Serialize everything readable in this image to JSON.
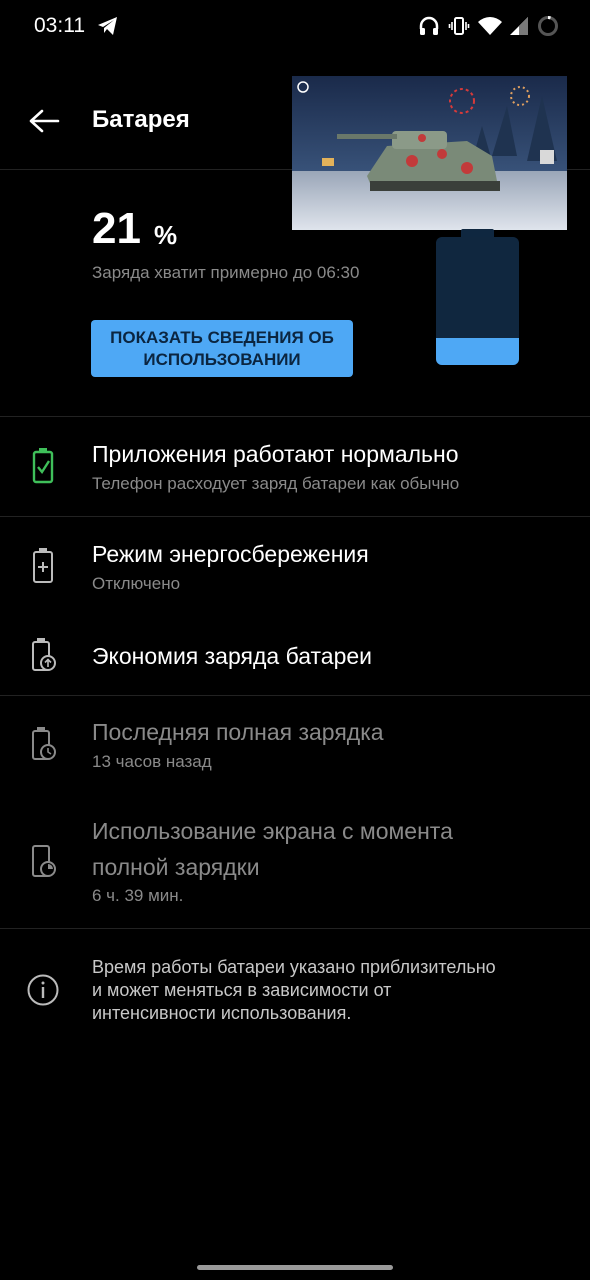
{
  "status_bar": {
    "time": "03:11",
    "icons": [
      "telegram-icon",
      "headphones-icon",
      "vibrate-icon",
      "wifi-icon",
      "signal-icon",
      "battery-ring-icon"
    ]
  },
  "header": {
    "title": "Батарея",
    "back_icon": "arrow-left-icon"
  },
  "battery": {
    "percent": "21",
    "percent_sign": "%",
    "level_fraction": 0.21,
    "estimate": "Заряда хватит примерно до 06:30",
    "usage_button": "ПОКАЗАТЬ СВЕДЕНИЯ ОБ ИСПОЛЬЗОВАНИИ",
    "accent": "#4ea8f5",
    "empty_color": "#10273f"
  },
  "items": [
    {
      "title": "Приложения работают нормально",
      "subtitle": "Телефон расходует заряд батареи как обычно",
      "icon": "battery-check-icon",
      "icon_color": "#3fbf5a"
    },
    {
      "title": "Режим энергосбережения",
      "subtitle": "Отключено",
      "icon": "battery-plus-icon"
    },
    {
      "title": "Экономия заряда батареи",
      "icon": "battery-schedule-icon"
    },
    {
      "title": "Последняя полная зарядка",
      "subtitle": "13 часов назад",
      "icon": "battery-clock-icon"
    },
    {
      "title_line1": "Использование экрана с момента",
      "title_line2": "полной зарядки",
      "subtitle": "6 ч. 39 мин.",
      "icon": "phone-usage-icon"
    }
  ],
  "info": {
    "text_line1": "Время работы батареи указано приблизительно",
    "text_line2": "и может меняться в зависимости от",
    "text_line3": "интенсивности использования.",
    "icon": "info-icon"
  }
}
